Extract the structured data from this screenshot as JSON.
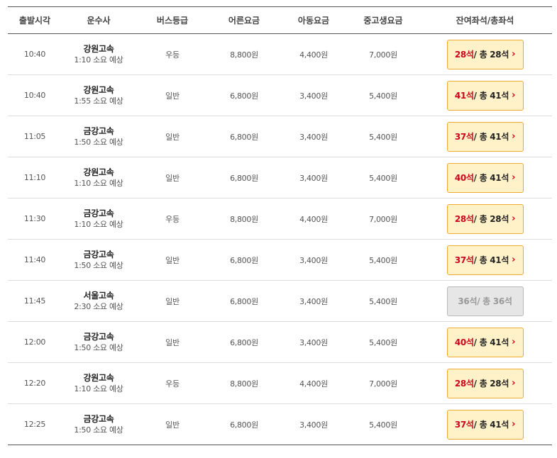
{
  "headers": {
    "time": "출발시각",
    "company": "운수사",
    "grade": "버스등급",
    "adult": "어른요금",
    "child": "아동요금",
    "student": "중고생요금",
    "seats": "잔여좌석/총좌석"
  },
  "rows": [
    {
      "time": "10:40",
      "company": "강원고속",
      "duration": "1:10 소요 예상",
      "grade": "우등",
      "adult": "8,800원",
      "child": "4,400원",
      "student": "7,000원",
      "remaining": "28석",
      "total": " / 총 28석",
      "available": true
    },
    {
      "time": "10:40",
      "company": "강원고속",
      "duration": "1:55 소요 예상",
      "grade": "일반",
      "adult": "6,800원",
      "child": "3,400원",
      "student": "5,400원",
      "remaining": "41석",
      "total": " / 총 41석",
      "available": true
    },
    {
      "time": "11:05",
      "company": "금강고속",
      "duration": "1:50 소요 예상",
      "grade": "일반",
      "adult": "6,800원",
      "child": "3,400원",
      "student": "5,400원",
      "remaining": "37석",
      "total": " / 총 41석",
      "available": true
    },
    {
      "time": "11:10",
      "company": "강원고속",
      "duration": "1:10 소요 예상",
      "grade": "일반",
      "adult": "6,800원",
      "child": "3,400원",
      "student": "5,400원",
      "remaining": "40석",
      "total": " / 총 41석",
      "available": true
    },
    {
      "time": "11:30",
      "company": "금강고속",
      "duration": "1:10 소요 예상",
      "grade": "우등",
      "adult": "8,800원",
      "child": "4,400원",
      "student": "7,000원",
      "remaining": "28석",
      "total": " / 총 28석",
      "available": true
    },
    {
      "time": "11:40",
      "company": "금강고속",
      "duration": "1:50 소요 예상",
      "grade": "일반",
      "adult": "6,800원",
      "child": "3,400원",
      "student": "5,400원",
      "remaining": "37석",
      "total": " / 총 41석",
      "available": true
    },
    {
      "time": "11:45",
      "company": "서울고속",
      "duration": "2:30 소요 예상",
      "grade": "일반",
      "adult": "6,800원",
      "child": "3,400원",
      "student": "5,400원",
      "remaining": "36석",
      "total": " / 총 36석",
      "available": false
    },
    {
      "time": "12:00",
      "company": "금강고속",
      "duration": "1:50 소요 예상",
      "grade": "일반",
      "adult": "6,800원",
      "child": "3,400원",
      "student": "5,400원",
      "remaining": "40석",
      "total": " / 총 41석",
      "available": true
    },
    {
      "time": "12:20",
      "company": "강원고속",
      "duration": "1:10 소요 예상",
      "grade": "우등",
      "adult": "8,800원",
      "child": "4,400원",
      "student": "7,000원",
      "remaining": "28석",
      "total": " / 총 28석",
      "available": true
    },
    {
      "time": "12:25",
      "company": "금강고속",
      "duration": "1:50 소요 예상",
      "grade": "일반",
      "adult": "6,800원",
      "child": "3,400원",
      "student": "5,400원",
      "remaining": "37석",
      "total": " / 총 41석",
      "available": true
    }
  ],
  "icons": {
    "seat_button_arrow": "chevron-right-icon"
  },
  "colors": {
    "accent_red": "#d0021b",
    "button_bg": "#fff2c8",
    "button_border": "#f0a830",
    "disabled_bg": "#e6e6e6"
  }
}
